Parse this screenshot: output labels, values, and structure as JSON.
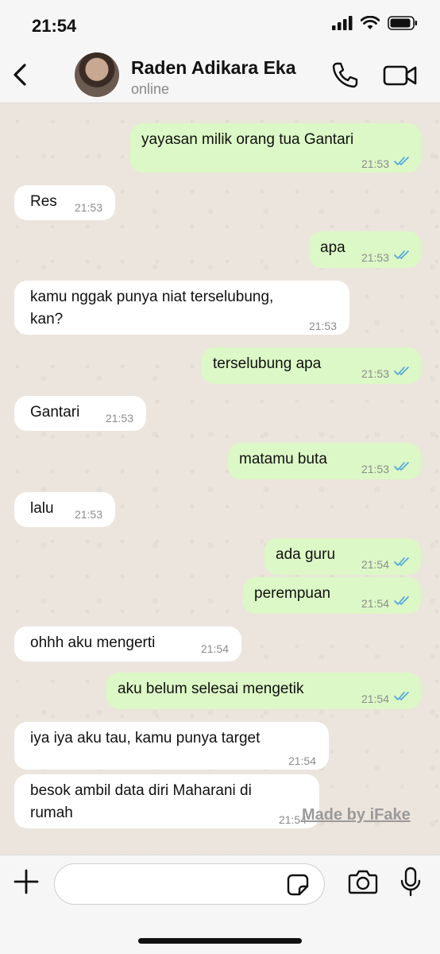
{
  "status_bar": {
    "time": "21:54"
  },
  "header": {
    "contact_name": "Raden Adikara Eka",
    "contact_status": "online"
  },
  "messages": [
    {
      "dir": "out",
      "text": [
        "yayasan milik orang tua Gantari"
      ],
      "time": "21:53",
      "read": true
    },
    {
      "dir": "in",
      "text": [
        "Res"
      ],
      "time": "21:53"
    },
    {
      "dir": "out",
      "text": [
        "apa"
      ],
      "time": "21:53",
      "read": true
    },
    {
      "dir": "in",
      "text": [
        "kamu nggak punya niat terselubung,",
        "kan?"
      ],
      "time": "21:53"
    },
    {
      "dir": "out",
      "text": [
        "terselubung apa"
      ],
      "time": "21:53",
      "read": true
    },
    {
      "dir": "in",
      "text": [
        "Gantari"
      ],
      "time": "21:53"
    },
    {
      "dir": "out",
      "text": [
        "matamu buta"
      ],
      "time": "21:53",
      "read": true
    },
    {
      "dir": "in",
      "text": [
        "lalu"
      ],
      "time": "21:53"
    },
    {
      "dir": "out",
      "text": [
        "ada guru"
      ],
      "time": "21:54",
      "read": true
    },
    {
      "dir": "out",
      "text": [
        "perempuan"
      ],
      "time": "21:54",
      "read": true
    },
    {
      "dir": "in",
      "text": [
        "ohhh aku mengerti"
      ],
      "time": "21:54"
    },
    {
      "dir": "out",
      "text": [
        "aku belum selesai mengetik"
      ],
      "time": "21:54",
      "read": true
    },
    {
      "dir": "in",
      "text": [
        "iya iya aku tau, kamu punya target"
      ],
      "time": "21:54"
    },
    {
      "dir": "in",
      "text": [
        "besok ambil data diri Maharani di",
        "rumah"
      ],
      "time": "21:54"
    }
  ],
  "watermark": "Made by iFake",
  "input": {
    "value": "",
    "placeholder": ""
  },
  "colors": {
    "outgoing_bubble": "#dcf8c6",
    "incoming_bubble": "#ffffff",
    "read_ticks": "#4fa3e0",
    "chat_background": "#ece5dd"
  }
}
